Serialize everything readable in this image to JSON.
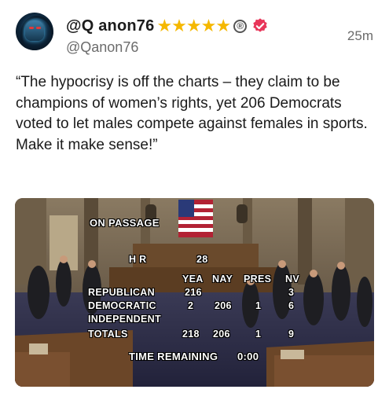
{
  "post": {
    "display_name": "@Q anon76",
    "handle": "@Qanon76",
    "time": "25m",
    "text": "“The hypocrisy is off the charts – they claim to be champions of women’s rights, yet 206 Democrats voted to let males compete against females in sports. Make it make sense!”",
    "star_count": 5,
    "star_icon": "star-icon",
    "registered_mark": "®"
  },
  "colors": {
    "star": "#f5b800",
    "verified": "#e8365a",
    "handle": "#6b6b6b"
  },
  "media": {
    "on_passage": "ON PASSAGE",
    "bill": "H R",
    "bill_number": "28",
    "headers": {
      "yea": "YEA",
      "nay": "NAY",
      "pres": "PRES",
      "nv": "NV"
    },
    "rows": [
      {
        "party": "REPUBLICAN",
        "yea": "216",
        "nay": "",
        "pres": "",
        "nv": "3"
      },
      {
        "party": "DEMOCRATIC",
        "yea": "2",
        "nay": "206",
        "pres": "1",
        "nv": "6"
      },
      {
        "party": "INDEPENDENT",
        "yea": "",
        "nay": "",
        "pres": "",
        "nv": ""
      }
    ],
    "totals": {
      "label": "TOTALS",
      "yea": "218",
      "nay": "206",
      "pres": "1",
      "nv": "9"
    },
    "time_remaining_label": "TIME REMAINING",
    "time_remaining_value": "0:00"
  }
}
